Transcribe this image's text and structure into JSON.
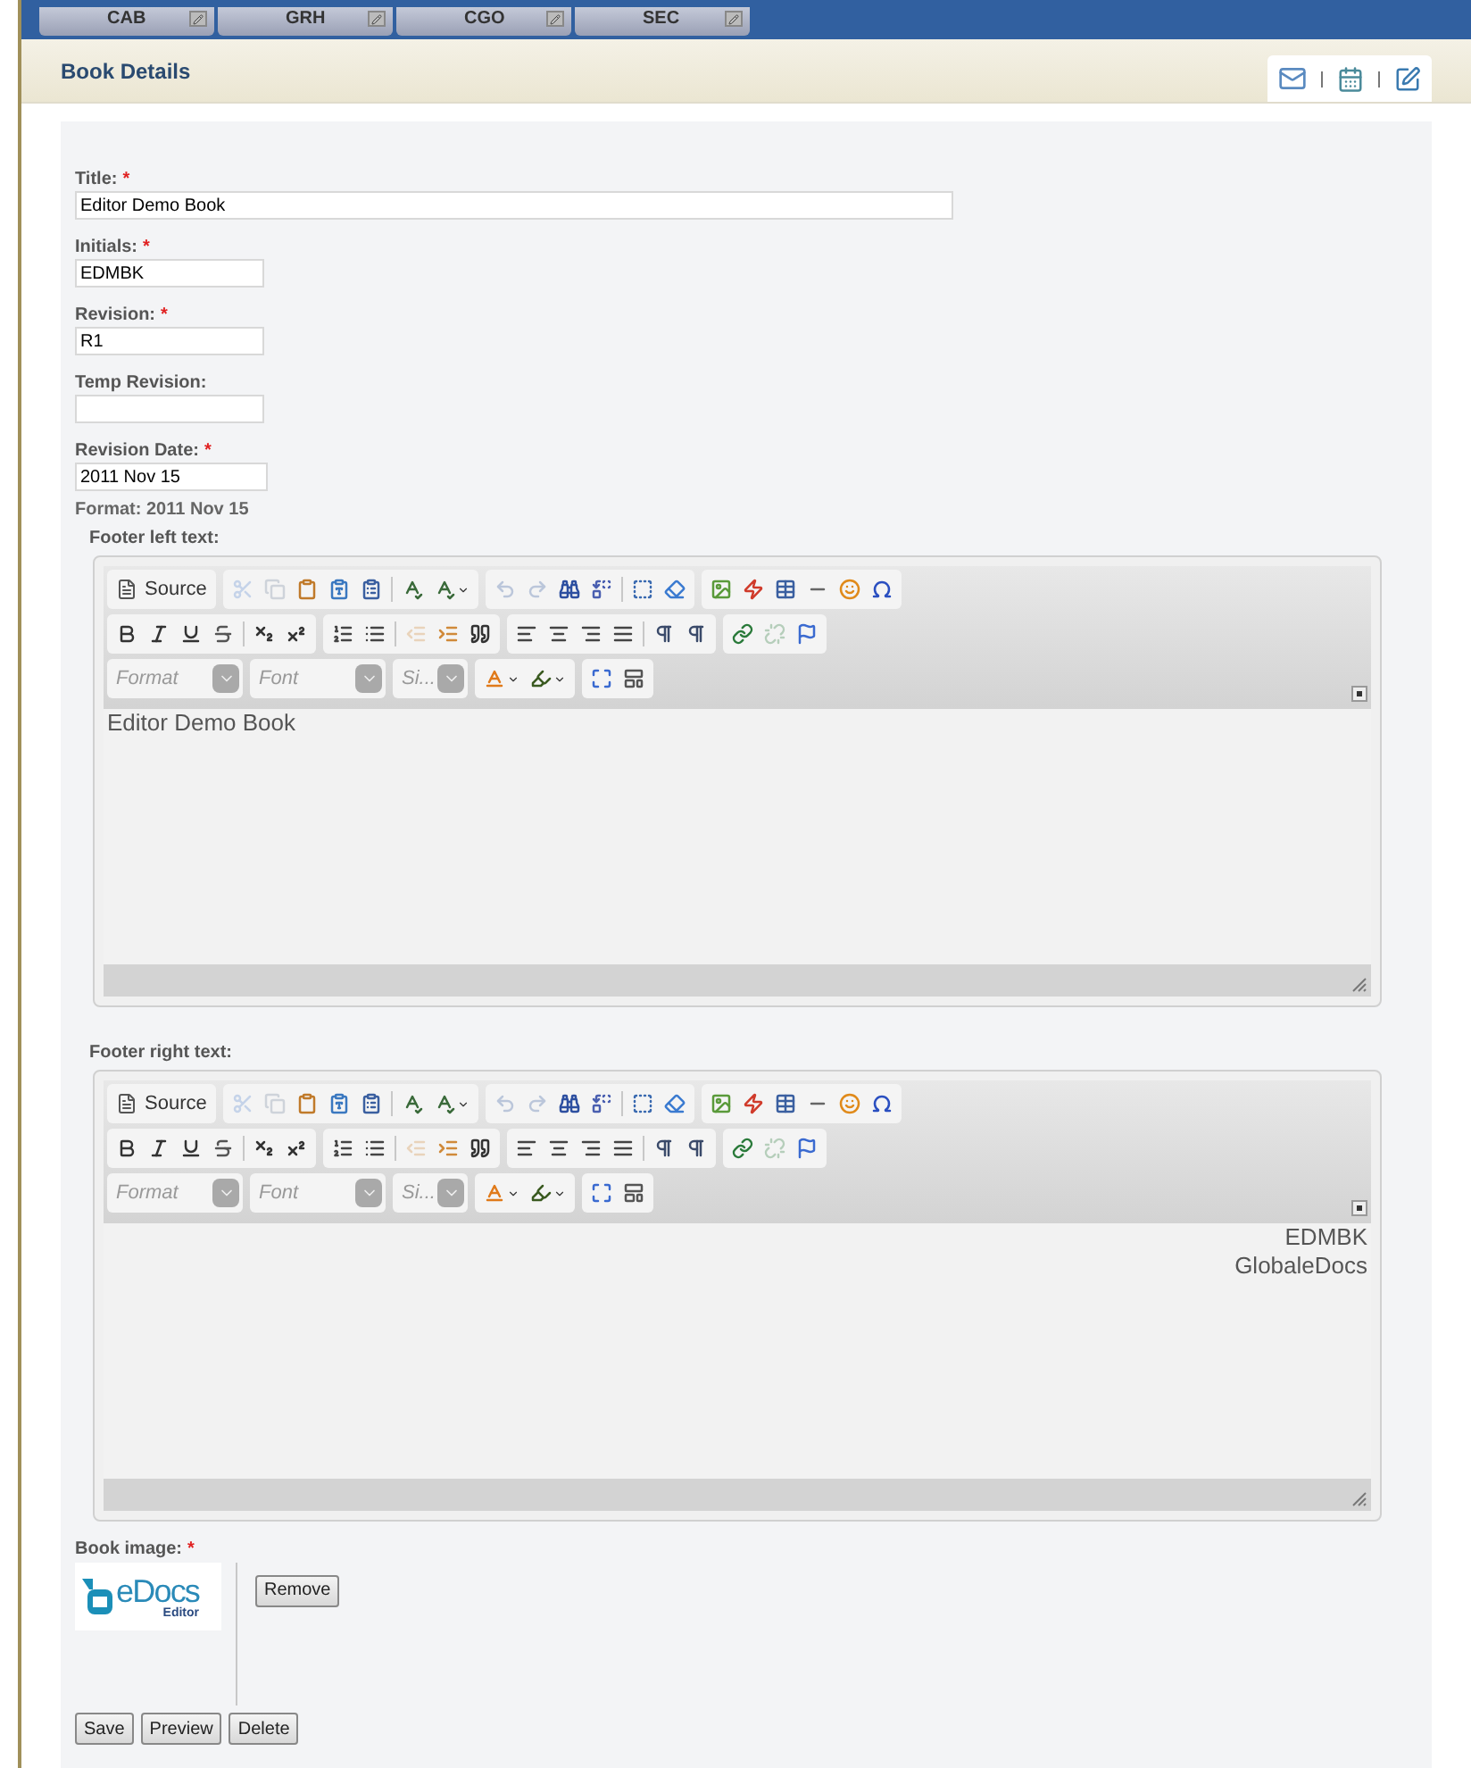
{
  "top_tabs": [
    {
      "label": "CAB"
    },
    {
      "label": "GRH"
    },
    {
      "label": "CGO"
    },
    {
      "label": "SEC"
    }
  ],
  "header": {
    "title": "Book Details"
  },
  "fields": [
    {
      "label": "Title:",
      "required_mark": "*",
      "value": "Editor Demo Book",
      "kind": "wide"
    },
    {
      "label": "Initials:",
      "required_mark": "*",
      "value": "EDMBK",
      "kind": "narrow"
    },
    {
      "label": "Revision:",
      "required_mark": "*",
      "value": "R1",
      "kind": "narrow"
    },
    {
      "label": "Temp Revision:",
      "kind": "narrow"
    },
    {
      "label": "Revision Date:",
      "required_mark": "*",
      "value": "2011 Nov 15",
      "kind": "date",
      "hint": "Format: 2011 Nov 15"
    }
  ],
  "editors": [
    {
      "label": "Footer left text:",
      "right_aligned": false,
      "lines": [
        "Editor Demo Book"
      ],
      "toolbar": [
        [
          [
            {
              "kind": "source",
              "label": "Source"
            }
          ],
          [
            {
              "kind": "cut",
              "disabled": true
            },
            {
              "kind": "copy",
              "disabled": true
            },
            {
              "kind": "paste",
              "disabled": false
            },
            {
              "kind": "paste-text",
              "disabled": false
            },
            {
              "kind": "paste-word",
              "disabled": false
            },
            {
              "kind": "sep"
            },
            {
              "kind": "spell",
              "disabled": false
            },
            {
              "kind": "spell-menu",
              "disabled": false
            }
          ],
          [
            {
              "kind": "undo",
              "disabled": true
            },
            {
              "kind": "redo",
              "disabled": true
            },
            {
              "kind": "find",
              "disabled": false
            },
            {
              "kind": "replace",
              "disabled": false
            },
            {
              "kind": "sep"
            },
            {
              "kind": "select-all",
              "disabled": false
            },
            {
              "kind": "eraser",
              "disabled": false
            }
          ],
          [
            {
              "kind": "image",
              "disabled": false
            },
            {
              "kind": "flash",
              "disabled": false
            },
            {
              "kind": "table",
              "disabled": false
            },
            {
              "kind": "rule",
              "disabled": false
            },
            {
              "kind": "smiley",
              "disabled": false
            },
            {
              "kind": "omega",
              "disabled": false
            }
          ]
        ],
        [
          [
            {
              "kind": "bold",
              "disabled": false
            },
            {
              "kind": "italic",
              "disabled": false
            },
            {
              "kind": "underline",
              "disabled": false
            },
            {
              "kind": "strike",
              "disabled": false
            },
            {
              "kind": "sep"
            },
            {
              "kind": "sub",
              "disabled": false
            },
            {
              "kind": "sup",
              "disabled": false
            }
          ],
          [
            {
              "kind": "ol",
              "disabled": false
            },
            {
              "kind": "ul",
              "disabled": false
            },
            {
              "kind": "sep"
            },
            {
              "kind": "outdent",
              "disabled": true
            },
            {
              "kind": "indent",
              "disabled": false
            },
            {
              "kind": "quote",
              "disabled": false
            }
          ],
          [
            {
              "kind": "align-left",
              "disabled": false
            },
            {
              "kind": "align-center",
              "disabled": false
            },
            {
              "kind": "align-right",
              "disabled": false
            },
            {
              "kind": "justify",
              "disabled": false
            },
            {
              "kind": "sep"
            },
            {
              "kind": "ltr",
              "disabled": false
            },
            {
              "kind": "rtl",
              "disabled": false
            }
          ],
          [
            {
              "kind": "link",
              "disabled": false
            },
            {
              "kind": "unlink",
              "disabled": true
            },
            {
              "kind": "anchor",
              "disabled": false
            }
          ]
        ],
        [
          [
            {
              "kind": "combo",
              "placeholder": "Format"
            }
          ],
          [
            {
              "kind": "combo",
              "placeholder": "Font"
            }
          ],
          [
            {
              "kind": "combo-small",
              "placeholder": "Si..."
            }
          ],
          [
            {
              "kind": "text-color",
              "disabled": false
            },
            {
              "kind": "bg-color",
              "disabled": false
            }
          ],
          [
            {
              "kind": "maximize",
              "disabled": false
            },
            {
              "kind": "blocks",
              "disabled": false
            }
          ]
        ]
      ]
    },
    {
      "label": "Footer right text:",
      "right_aligned": true,
      "lines": [
        "EDMBK",
        "GlobaleDocs"
      ],
      "toolbar": [
        [
          [
            {
              "kind": "source",
              "label": "Source"
            }
          ],
          [
            {
              "kind": "cut",
              "disabled": true
            },
            {
              "kind": "copy",
              "disabled": true
            },
            {
              "kind": "paste",
              "disabled": false
            },
            {
              "kind": "paste-text",
              "disabled": false
            },
            {
              "kind": "paste-word",
              "disabled": false
            },
            {
              "kind": "sep"
            },
            {
              "kind": "spell",
              "disabled": false
            },
            {
              "kind": "spell-menu",
              "disabled": false
            }
          ],
          [
            {
              "kind": "undo",
              "disabled": true
            },
            {
              "kind": "redo",
              "disabled": true
            },
            {
              "kind": "find",
              "disabled": false
            },
            {
              "kind": "replace",
              "disabled": false
            },
            {
              "kind": "sep"
            },
            {
              "kind": "select-all",
              "disabled": false
            },
            {
              "kind": "eraser",
              "disabled": false
            }
          ],
          [
            {
              "kind": "image",
              "disabled": false
            },
            {
              "kind": "flash",
              "disabled": false
            },
            {
              "kind": "table",
              "disabled": false
            },
            {
              "kind": "rule",
              "disabled": false
            },
            {
              "kind": "smiley",
              "disabled": false
            },
            {
              "kind": "omega",
              "disabled": false
            }
          ]
        ],
        [
          [
            {
              "kind": "bold",
              "disabled": false
            },
            {
              "kind": "italic",
              "disabled": false
            },
            {
              "kind": "underline",
              "disabled": false
            },
            {
              "kind": "strike",
              "disabled": false
            },
            {
              "kind": "sep"
            },
            {
              "kind": "sub",
              "disabled": false
            },
            {
              "kind": "sup",
              "disabled": false
            }
          ],
          [
            {
              "kind": "ol",
              "disabled": false
            },
            {
              "kind": "ul",
              "disabled": false
            },
            {
              "kind": "sep"
            },
            {
              "kind": "outdent",
              "disabled": true
            },
            {
              "kind": "indent",
              "disabled": false
            },
            {
              "kind": "quote",
              "disabled": false
            }
          ],
          [
            {
              "kind": "align-left",
              "disabled": false
            },
            {
              "kind": "align-center",
              "disabled": false
            },
            {
              "kind": "align-right",
              "disabled": false
            },
            {
              "kind": "justify",
              "disabled": false
            },
            {
              "kind": "sep"
            },
            {
              "kind": "ltr",
              "disabled": false
            },
            {
              "kind": "rtl",
              "disabled": false
            }
          ],
          [
            {
              "kind": "link",
              "disabled": false
            },
            {
              "kind": "unlink",
              "disabled": true
            },
            {
              "kind": "anchor",
              "disabled": false
            }
          ]
        ],
        [
          [
            {
              "kind": "combo",
              "placeholder": "Format"
            }
          ],
          [
            {
              "kind": "combo",
              "placeholder": "Font"
            }
          ],
          [
            {
              "kind": "combo-small",
              "placeholder": "Si..."
            }
          ],
          [
            {
              "kind": "text-color",
              "disabled": false
            },
            {
              "kind": "bg-color",
              "disabled": false
            }
          ],
          [
            {
              "kind": "maximize",
              "disabled": false
            },
            {
              "kind": "blocks",
              "disabled": false
            }
          ]
        ]
      ]
    }
  ],
  "book_image": {
    "label": "Book image:",
    "required_mark": "*",
    "logo_name": "eDocs",
    "logo_sub": "Editor",
    "button": "Remove"
  },
  "buttons": [
    "Save",
    "Preview",
    "Delete"
  ]
}
